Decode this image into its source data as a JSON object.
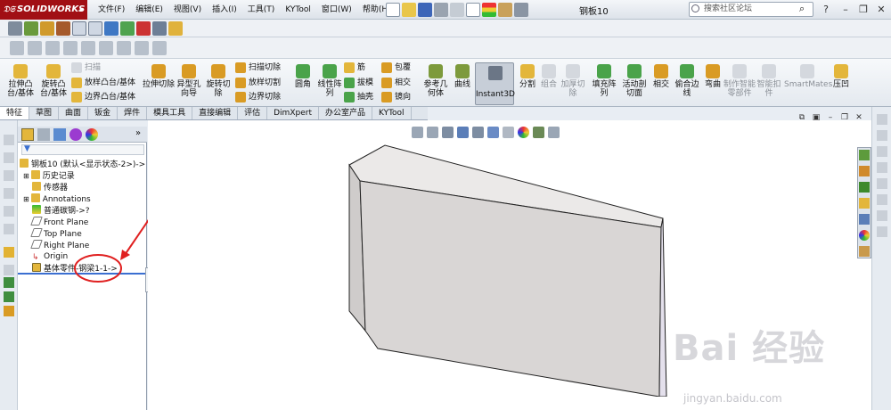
{
  "app": {
    "logo": "SOLIDWORKS",
    "document_title": "钢板10"
  },
  "menu": [
    "文件(F)",
    "编辑(E)",
    "视图(V)",
    "插入(I)",
    "工具(T)",
    "KYTool",
    "窗口(W)",
    "帮助(H)"
  ],
  "search": {
    "placeholder": "搜索社区论坛"
  },
  "command_manager": {
    "extrude_boss": "拉伸凸台/基体",
    "revolve_boss": "旋转凸台/基体",
    "sweep": "扫描",
    "loft": "放样凸台/基体",
    "boundary_boss": "边界凸台/基体",
    "extrude_cut": "拉伸切除",
    "hole_wizard": "异型孔向导",
    "revolve_cut": "旋转切除",
    "swept_cut": "扫描切除",
    "lofted_cut": "放样切割",
    "boundary_cut": "边界切除",
    "fillet": "圆角",
    "linear_pattern": "线性阵列",
    "rib": "筋",
    "draft": "拔模",
    "shell": "抽壳",
    "wrap": "包覆",
    "intersect": "相交",
    "mirror": "镜向",
    "ref_geometry": "参考几何体",
    "curves": "曲线",
    "instant3d": "Instant3D",
    "split": "分割",
    "combine": "组合",
    "thicken_cut": "加厚切除",
    "fill_pattern": "填充阵列",
    "active_cut": "活动剖切面",
    "intersect2": "相交",
    "freeform_edge": "偷合边线",
    "flex": "弯曲",
    "make_smart_part": "制作智能零部件",
    "smart_fastener": "智能扣件",
    "smartmates": "SmartMates",
    "indent": "压凹"
  },
  "tabs": [
    "特征",
    "草图",
    "曲面",
    "钣金",
    "焊件",
    "模具工具",
    "直接编辑",
    "评估",
    "DimXpert",
    "办公室产品",
    "KYTool"
  ],
  "feature_tree": [
    {
      "label": "钢板10 (默认<显示状态-2>)->",
      "icon": "part-icon"
    },
    {
      "label": "历史记录",
      "icon": "history-icon"
    },
    {
      "label": "传感器",
      "icon": "sensor-icon"
    },
    {
      "label": "Annotations",
      "icon": "annotations-icon"
    },
    {
      "label": "普通碳钢->?",
      "icon": "material-icon"
    },
    {
      "label": "Front Plane",
      "icon": "plane-icon"
    },
    {
      "label": "Top Plane",
      "icon": "plane-icon"
    },
    {
      "label": "Right Plane",
      "icon": "plane-icon"
    },
    {
      "label": "Origin",
      "icon": "origin-icon"
    },
    {
      "label": "基体零件-钢梁1-1->",
      "icon": "base-part-icon"
    }
  ],
  "watermark": {
    "main": "Bai 经验",
    "sub": "jingyan.baidu.com"
  },
  "colors": {
    "logo_bg": "#a10f14",
    "annotation_red": "#e02020",
    "model_face": "#d9d6d5"
  }
}
